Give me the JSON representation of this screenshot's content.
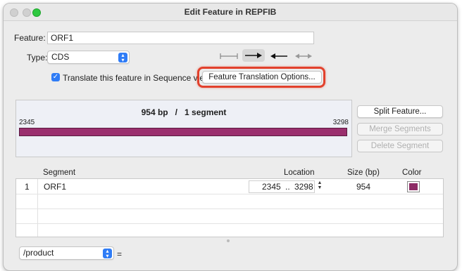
{
  "window": {
    "title": "Edit Feature in REPFIB"
  },
  "feature": {
    "label": "Feature:",
    "value": "ORF1"
  },
  "type": {
    "label": "Type:",
    "value": "CDS"
  },
  "translate": {
    "label": "Translate this feature in Sequence view",
    "checked": true
  },
  "options_button": "Feature Translation Options...",
  "map": {
    "summary_bp": "954 bp",
    "separator": "/",
    "summary_segments": "1 segment",
    "start": "2345",
    "end": "3298",
    "bar_color": "#9a2f6e"
  },
  "side_buttons": {
    "split": "Split Feature...",
    "merge": "Merge Segments",
    "delete": "Delete Segment"
  },
  "table": {
    "headers": {
      "segment": "Segment",
      "location": "Location",
      "size": "Size (bp)",
      "color": "Color"
    },
    "rows": [
      {
        "index": "1",
        "name": "ORF1",
        "start": "2345",
        "dots": "..",
        "end": "3298",
        "size": "954",
        "color": "#8e2c66"
      }
    ]
  },
  "qualifier": {
    "value": "/product",
    "equals": "="
  },
  "icons": [
    "directionless-icon",
    "forward-arrow-icon",
    "reverse-arrow-icon",
    "bidirectional-arrow-icon",
    "checkmark-icon",
    "chevron-updown-icon",
    "stepper-icon"
  ]
}
